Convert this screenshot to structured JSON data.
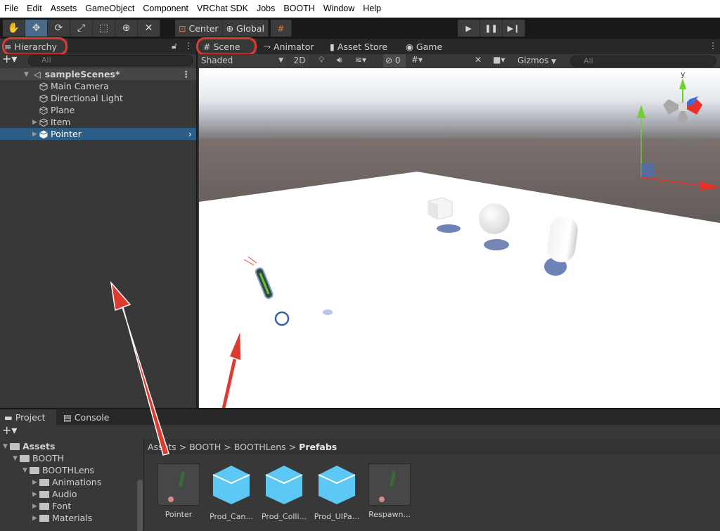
{
  "menu": [
    "File",
    "Edit",
    "Assets",
    "GameObject",
    "Component",
    "VRChat SDK",
    "Jobs",
    "BOOTH",
    "Window",
    "Help"
  ],
  "toolbar": {
    "pivot_label": "Center",
    "space_label": "Global"
  },
  "hierarchy": {
    "tab_label": "Hierarchy",
    "search_placeholder": "All",
    "scene_name": "sampleScenes*",
    "items": [
      {
        "label": "Main Camera",
        "expandable": false,
        "selected": false
      },
      {
        "label": "Directional Light",
        "expandable": false,
        "selected": false
      },
      {
        "label": "Plane",
        "expandable": false,
        "selected": false
      },
      {
        "label": "Item",
        "expandable": true,
        "selected": false
      },
      {
        "label": "Pointer",
        "expandable": true,
        "selected": true
      }
    ]
  },
  "scene_tabs": {
    "scene": "Scene",
    "animator": "Animator",
    "asset_store": "Asset Store",
    "game": "Game"
  },
  "scene_toolbar": {
    "shading_mode": "Shaded",
    "mode_2d": "2D",
    "hidden_count": "0",
    "gizmos_label": "Gizmos",
    "search_placeholder": "All"
  },
  "scene_view": {
    "gizmo_y_label": "y",
    "projection_label": "Persp"
  },
  "project": {
    "tabs": [
      "Project",
      "Console"
    ],
    "breadcrumb": [
      "Assets",
      "BOOTH",
      "BOOTHLens",
      "Prefabs"
    ],
    "tree": [
      {
        "label": "Assets",
        "level": 0,
        "bold": true
      },
      {
        "label": "BOOTH",
        "level": 1,
        "bold": false
      },
      {
        "label": "BOOTHLens",
        "level": 2,
        "bold": false
      },
      {
        "label": "Animations",
        "level": 3,
        "bold": false
      },
      {
        "label": "Audio",
        "level": 3,
        "bold": false
      },
      {
        "label": "Font",
        "level": 3,
        "bold": false
      },
      {
        "label": "Materials",
        "level": 3,
        "bold": false
      }
    ],
    "assets": [
      {
        "label": "Pointer",
        "kind": "prefab-preview"
      },
      {
        "label": "Prod_Can...",
        "kind": "prefab-cube"
      },
      {
        "label": "Prod_Colli...",
        "kind": "prefab-cube"
      },
      {
        "label": "Prod_UIPa...",
        "kind": "prefab-cube"
      },
      {
        "label": "Respawn...",
        "kind": "prefab-preview"
      }
    ]
  },
  "colors": {
    "annotation_red": "#e03a2f",
    "selection_blue": "#2c5d87",
    "prefab_cube": "#5bc8f5",
    "axis_x": "#e8302a",
    "axis_y": "#6fd12c",
    "axis_z": "#3b6fe0"
  }
}
